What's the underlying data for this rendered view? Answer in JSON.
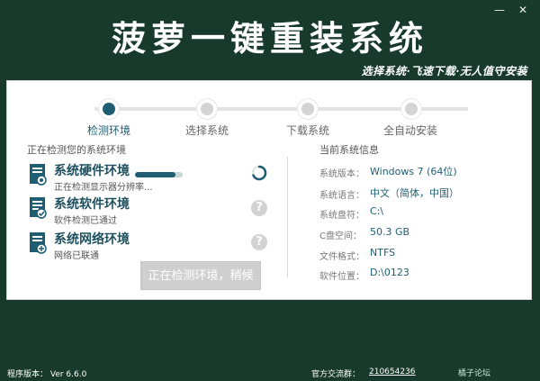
{
  "window": {
    "minimize": "—",
    "close": "✕"
  },
  "title": "菠萝一键重装系统",
  "slogan": "选择系统·飞速下载·无人值守安装",
  "steps": [
    {
      "label": "检测环境",
      "active": true
    },
    {
      "label": "选择系统",
      "active": false
    },
    {
      "label": "下载系统",
      "active": false
    },
    {
      "label": "全自动安装",
      "active": false
    }
  ],
  "left": {
    "heading": "正在检测您的系统环境",
    "items": [
      {
        "name": "系统硬件环境",
        "sub": "正在检测显示器分辨率..."
      },
      {
        "name": "系统软件环境",
        "sub": "软件检测已通过"
      },
      {
        "name": "系统网络环境",
        "sub": "网络已联通"
      }
    ],
    "hardware_progress": 0.85,
    "qmark": "?"
  },
  "button": {
    "label": "正在检测环境，稍候"
  },
  "right": {
    "heading": "当前系统信息",
    "rows": [
      {
        "k": "系统版本：",
        "v": "Windows 7 (64位)"
      },
      {
        "k": "系统语言：",
        "v": "中文（简体，中国）"
      },
      {
        "k": "系统盘符：",
        "v": "C:\\"
      },
      {
        "k": "C盘空间：",
        "v": "50.3 GB"
      },
      {
        "k": "文件格式：",
        "v": "NTFS"
      },
      {
        "k": "软件位置：",
        "v": "D:\\0123"
      }
    ]
  },
  "footer": {
    "version_label": "程序版本： Ver 6.6.0",
    "qq_label": "官方交流群：",
    "qq_value": "210654236",
    "watermark": "橘子论坛"
  },
  "colors": {
    "bg": "#173a2d",
    "accent": "#1f5e72",
    "panel": "#ffffff"
  }
}
